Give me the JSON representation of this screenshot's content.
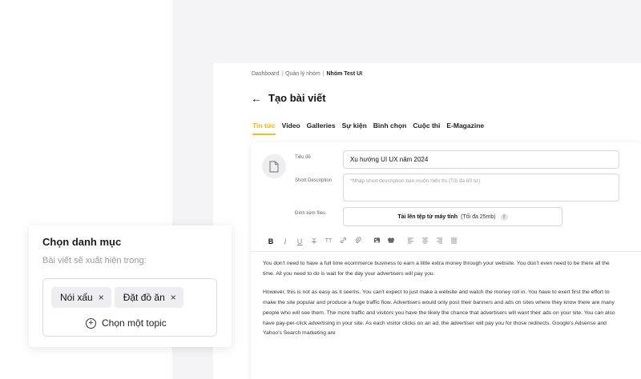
{
  "breadcrumb": {
    "items": [
      "Dashboard",
      "Quản lý nhóm"
    ],
    "current": "Nhóm Test UI",
    "separator": "|"
  },
  "page": {
    "back_icon": "arrow-left-icon",
    "title": "Tạo bài viết"
  },
  "tabs": [
    {
      "label": "Tin tức",
      "active": true
    },
    {
      "label": "Video"
    },
    {
      "label": "Galleries"
    },
    {
      "label": "Sự kiện"
    },
    {
      "label": "Bình chọn"
    },
    {
      "label": "Cuộc thi"
    },
    {
      "label": "E-Magazine"
    }
  ],
  "form": {
    "title_label": "Tiêu đề",
    "title_value": "Xu hướng UI UX năm 2024",
    "short_desc_label": "Short Description",
    "short_desc_placeholder": "*Nhập short description bạn muốn hiển thị (Tối đa 80 từ)",
    "attach_label": "Đính kèm files",
    "upload_label": "Tải lên tệp từ máy tính",
    "upload_hint": "(Tối đa 25mb)"
  },
  "toolbar": {
    "bold": "B",
    "italic": "I",
    "underline": "U",
    "strike": "T",
    "text_size": "TT"
  },
  "content": {
    "p1": "You don't need to have a full time ecommerce business to earn a little extra money through your website. You don't even need to be there all the time. All you need to do is wait for the day your advertisers will pay you.",
    "p2": "However, this is not as easy as it seems. You can't expect to just make a website and watch the money roll in. You have to exert first the effort to make the site popular and produce a huge traffic flow. Advertisers would only post their banners and ads on sites where they know there are many people who will see them. The more traffic and visitors you have the likely the chance that advertisers will want their ads on your site. You can also have pay-per-click advertising in your site. As each visitor clicks on an ad, the advertiser will pay you for those redirects. Google's Adsense and Yahoo's Search marketing are"
  },
  "category": {
    "title": "Chọn danh mục",
    "subtitle": "Bài viết sẽ xuất hiện trong:",
    "chips": [
      {
        "label": "Nói xấu",
        "remove": "×"
      },
      {
        "label": "Đặt đồ ăn",
        "remove": "×"
      }
    ],
    "choose_label": "Chọn một topic",
    "plus": "+"
  },
  "colors": {
    "accent": "#f2c21b",
    "backdrop": "#f4f4f6"
  }
}
